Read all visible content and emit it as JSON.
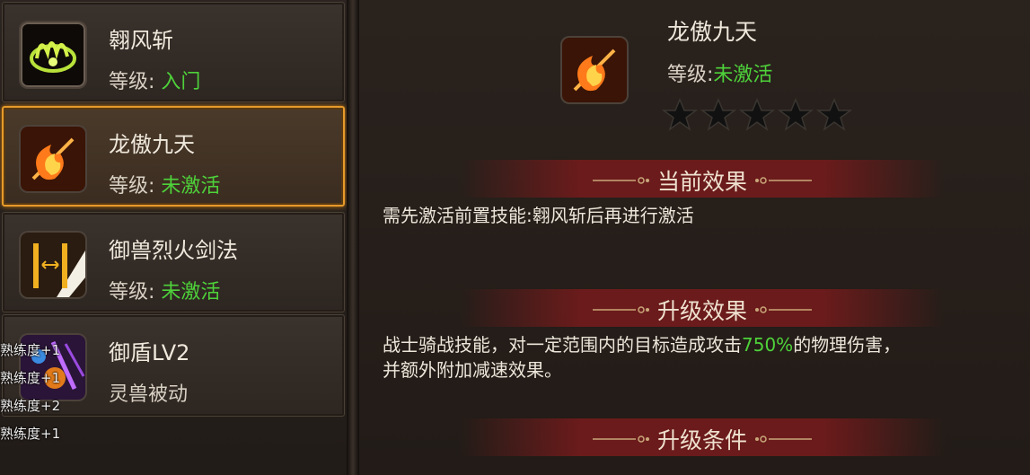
{
  "skills": [
    {
      "name": "翱风斩",
      "level_label": "等级:",
      "level_value": "入门",
      "level_color": "#4ed23a"
    },
    {
      "name": "龙傲九天",
      "level_label": "等级:",
      "level_value": "未激活",
      "level_color": "#4ed23a",
      "selected": true
    },
    {
      "name": "御兽烈火剑法",
      "level_label": "等级:",
      "level_value": "未激活",
      "level_color": "#4ed23a"
    },
    {
      "name": "御盾LV2",
      "level_label": "",
      "level_value": "灵兽被动",
      "level_color": "#d9d1c4"
    }
  ],
  "float_texts": [
    "熟练度+1",
    "熟练度+1",
    "熟练度+2",
    "熟练度+1"
  ],
  "detail": {
    "name": "龙傲九天",
    "level_label": "等级:",
    "level_value": "未激活",
    "stars_filled": 0,
    "stars_total": 5,
    "current_effect_title": "当前效果",
    "current_effect_text": "需先激活前置技能:翱风斩后再进行激活",
    "upgrade_effect_title": "升级效果",
    "upgrade_effect_text_1": "战士骑战技能，对一定范围内的目标造成攻击",
    "upgrade_effect_percent": "750%",
    "upgrade_effect_text_2": "的物理伤害，",
    "upgrade_effect_text_3": "并额外附加减速效果。",
    "upgrade_condition_title": "升级条件"
  },
  "icons": [
    "wing-slash-icon",
    "flame-dragon-icon",
    "beast-sword-icon",
    "shield-icon"
  ],
  "colors": {
    "accent": "#e69a2a",
    "green": "#4ed23a",
    "banner": "#6b1b1b"
  }
}
